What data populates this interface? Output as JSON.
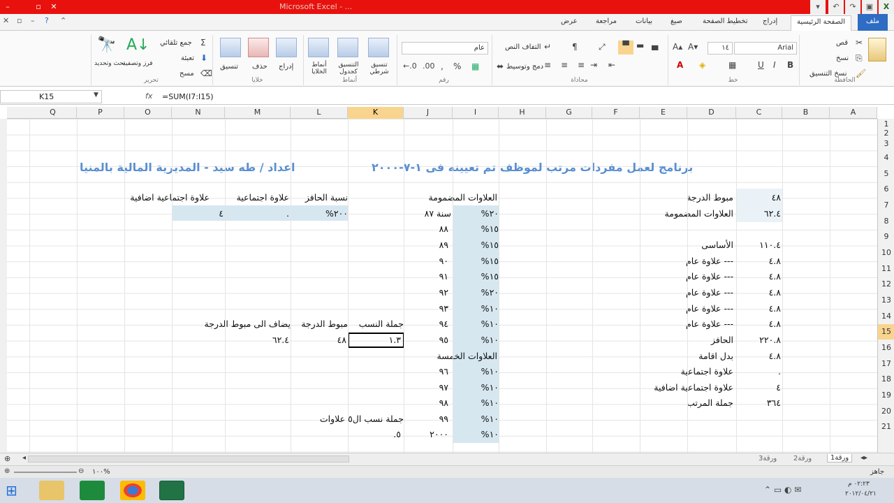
{
  "window": {
    "title": "Microsoft Excel - ...",
    "controls": [
      "▾",
      "▫",
      "–",
      "✕"
    ]
  },
  "menu": {
    "file": "ملف",
    "tabs": [
      "الصفحة الرئيسية",
      "إدراج",
      "تخطيط الصفحة",
      "صيغ",
      "بيانات",
      "مراجعة",
      "عرض"
    ]
  },
  "ribbon": {
    "clipboard": {
      "label": "الحافظة",
      "cut": "قص",
      "copy": "نسخ",
      "paste": "نسخ التنسيق"
    },
    "font": {
      "label": "خط",
      "name": "Arial",
      "size": "١٤"
    },
    "alignment": {
      "label": "محاذاة",
      "wrap": "التفاف النص",
      "merge": "دمج وتوسيط"
    },
    "number": {
      "label": "رقم",
      "format": "عام"
    },
    "styles": {
      "label": "أنماط",
      "cond": "تنسيق شرطي",
      "table": "التنسيق كجدول",
      "cell": "أنماط الخلايا"
    },
    "cells": {
      "label": "خلايا",
      "insert": "إدراج",
      "delete": "حذف",
      "format": "تنسيق"
    },
    "editing": {
      "label": "تحرير",
      "autosum": "جمع تلقائي",
      "fill": "تعبئة",
      "clear": "مسح",
      "sort": "فرز وتصفية",
      "find": "بحث وتحديد"
    }
  },
  "formula": {
    "cell": "K15",
    "fx": "fx",
    "value": "=SUM(I7:I15)"
  },
  "columns": [
    "A",
    "B",
    "C",
    "D",
    "E",
    "F",
    "G",
    "H",
    "I",
    "J",
    "K",
    "L",
    "M",
    "N",
    "O",
    "P",
    "Q"
  ],
  "selected_column": "K",
  "rows": [
    "1",
    "2",
    "3",
    "4",
    "5",
    "6",
    "7",
    "8",
    "9",
    "10",
    "11",
    "12",
    "13",
    "14",
    "15",
    "16",
    "17",
    "18",
    "19",
    "20",
    "21"
  ],
  "selected_row": "15",
  "sheet": {
    "header_main": "برنامج لعمل مفردات مرتب لموظف تم تعيينه فى ١-٧-٢٠٠٠",
    "header_author": "اعداد / طه سيد - المديرية المالية بالمنيا",
    "c6": "٤٨",
    "d6": "مبوط الدرجة",
    "c7": "٦٢.٤",
    "d7": "العلاوات المضمومة",
    "c9": "١١٠.٤",
    "d9": "الأساسى",
    "c10": "٤.٨",
    "d10": "علاوة عام ---",
    "c11": "٤.٨",
    "d11": "علاوة عام ---",
    "c12": "٤.٨",
    "d12": "علاوة عام ---",
    "c13": "٤.٨",
    "d13": "علاوة عام ---",
    "c14": "٤.٨",
    "d14": "علاوة عام ---",
    "c15": "٢٢٠.٨",
    "d15": "الحافز",
    "c16": "٤.٨",
    "d16": "بدل اقامة",
    "c17": ".",
    "d17": "علاوة اجتماعية",
    "c18": "٤",
    "d18": "علاوة اجتماعية اضافية",
    "c19": "٣٦٤",
    "d19": "جملة المرتب",
    "j6": "العلاوات المضمومة",
    "i7": "%٢٠",
    "j7": "سنة ٨٧",
    "i8": "%١٥",
    "j8": "٨٨",
    "i9": "%١٥",
    "j9": "٨٩",
    "i10": "%١٥",
    "j10": "٩٠",
    "i11": "%١٥",
    "j11": "٩١",
    "i12": "%٢٠",
    "j12": "٩٢",
    "i13": "%١٠",
    "j13": "٩٣",
    "i14": "%١٠",
    "j14": "٩٤",
    "i15": "%١٠",
    "j15": "٩٥",
    "j16": "العلاوات الخمسة",
    "i17": "%١٠",
    "j17": "٩٦",
    "i18": "%١٠",
    "j18": "٩٧",
    "i19": "%١٠",
    "j19": "٩٨",
    "i20": "%١٠",
    "j20": "٩٩",
    "i21": "%١٠",
    "j21": "٢٠٠٠",
    "l6": "نسبة الحافز",
    "m6": "علاوة اجتماعية",
    "n6": "علاوة اجتماعية اضافية",
    "l7": "%٢٠٠",
    "m7": ".",
    "n7": "٤",
    "k14": "جملة النسب",
    "l14": "مبوط الدرجة",
    "n14": "يضاف الى مبوط الدرجة",
    "k15": "١.٣",
    "l15": "٤٨",
    "n15": "٦٢.٤",
    "l20": "جملة نسب ال٥ علاوات",
    "k21": ".٥"
  },
  "sheets": [
    "ورقة1",
    "ورقة2",
    "ورقة3"
  ],
  "status": {
    "ready": "جاهز",
    "zoom": "١٠٠%"
  },
  "taskbar": {
    "time": "٠٢:٢٣ م",
    "date": "٢٠١٢/٠٤/٢١"
  }
}
